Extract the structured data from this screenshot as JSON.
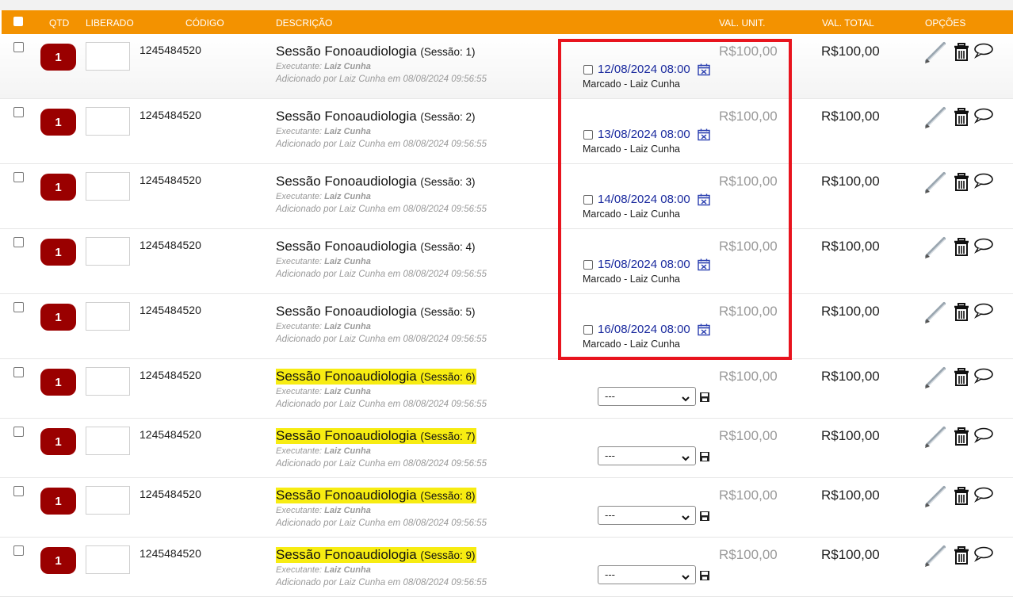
{
  "header": {
    "qtd": "QTD",
    "liberado": "LIBERADO",
    "codigo": "CÓDIGO",
    "descricao": "DESCRIÇÃO",
    "val_unit": "VAL. UNIT.",
    "val_total": "VAL. TOTAL",
    "opcoes": "OPÇÕES"
  },
  "rows": [
    {
      "qty": "1",
      "code": "1245484520",
      "title": "Sessão Fonoaudiologia",
      "session": "(Sessão: 1)",
      "exec_label": "Executante:",
      "exec_name": "Laiz Cunha",
      "added": "Adicionado por Laiz Cunha em 08/08/2024 09:56:55",
      "unit": "R$100,00",
      "total": "R$100,00",
      "date": "12/08/2024 08:00",
      "status": "Marcado - Laiz Cunha"
    },
    {
      "qty": "1",
      "code": "1245484520",
      "title": "Sessão Fonoaudiologia",
      "session": "(Sessão: 2)",
      "exec_label": "Executante:",
      "exec_name": "Laiz Cunha",
      "added": "Adicionado por Laiz Cunha em 08/08/2024 09:56:55",
      "unit": "R$100,00",
      "total": "R$100,00",
      "date": "13/08/2024 08:00",
      "status": "Marcado - Laiz Cunha"
    },
    {
      "qty": "1",
      "code": "1245484520",
      "title": "Sessão Fonoaudiologia",
      "session": "(Sessão: 3)",
      "exec_label": "Executante:",
      "exec_name": "Laiz Cunha",
      "added": "Adicionado por Laiz Cunha em 08/08/2024 09:56:55",
      "unit": "R$100,00",
      "total": "R$100,00",
      "date": "14/08/2024 08:00",
      "status": "Marcado - Laiz Cunha"
    },
    {
      "qty": "1",
      "code": "1245484520",
      "title": "Sessão Fonoaudiologia",
      "session": "(Sessão: 4)",
      "exec_label": "Executante:",
      "exec_name": "Laiz Cunha",
      "added": "Adicionado por Laiz Cunha em 08/08/2024 09:56:55",
      "unit": "R$100,00",
      "total": "R$100,00",
      "date": "15/08/2024 08:00",
      "status": "Marcado - Laiz Cunha"
    },
    {
      "qty": "1",
      "code": "1245484520",
      "title": "Sessão Fonoaudiologia",
      "session": "(Sessão: 5)",
      "exec_label": "Executante:",
      "exec_name": "Laiz Cunha",
      "added": "Adicionado por Laiz Cunha em 08/08/2024 09:56:55",
      "unit": "R$100,00",
      "total": "R$100,00",
      "date": "16/08/2024 08:00",
      "status": "Marcado - Laiz Cunha"
    },
    {
      "qty": "1",
      "code": "1245484520",
      "title": "Sessão Fonoaudiologia",
      "session": "(Sessão: 6)",
      "exec_label": "Executante:",
      "exec_name": "Laiz Cunha",
      "added": "Adicionado por Laiz Cunha em 08/08/2024 09:56:55",
      "unit": "R$100,00",
      "total": "R$100,00",
      "select": "---"
    },
    {
      "qty": "1",
      "code": "1245484520",
      "title": "Sessão Fonoaudiologia",
      "session": "(Sessão: 7)",
      "exec_label": "Executante:",
      "exec_name": "Laiz Cunha",
      "added": "Adicionado por Laiz Cunha em 08/08/2024 09:56:55",
      "unit": "R$100,00",
      "total": "R$100,00",
      "select": "---"
    },
    {
      "qty": "1",
      "code": "1245484520",
      "title": "Sessão Fonoaudiologia",
      "session": "(Sessão: 8)",
      "exec_label": "Executante:",
      "exec_name": "Laiz Cunha",
      "added": "Adicionado por Laiz Cunha em 08/08/2024 09:56:55",
      "unit": "R$100,00",
      "total": "R$100,00",
      "select": "---"
    },
    {
      "qty": "1",
      "code": "1245484520",
      "title": "Sessão Fonoaudiologia",
      "session": "(Sessão: 9)",
      "exec_label": "Executante:",
      "exec_name": "Laiz Cunha",
      "added": "Adicionado por Laiz Cunha em 08/08/2024 09:56:55",
      "unit": "R$100,00",
      "total": "R$100,00",
      "select": "---"
    }
  ],
  "icons": {
    "edit": "pencil-icon",
    "delete": "trash-icon",
    "comment": "comment-icon",
    "calendar": "calendar-cancel-icon",
    "save": "floppy-disk-icon"
  },
  "colors": {
    "header": "#f39200",
    "qty_badge": "#9a0000",
    "highlight": "#f7ec12",
    "annotation_box": "#e8141e",
    "date_link": "#1a2a9e"
  }
}
